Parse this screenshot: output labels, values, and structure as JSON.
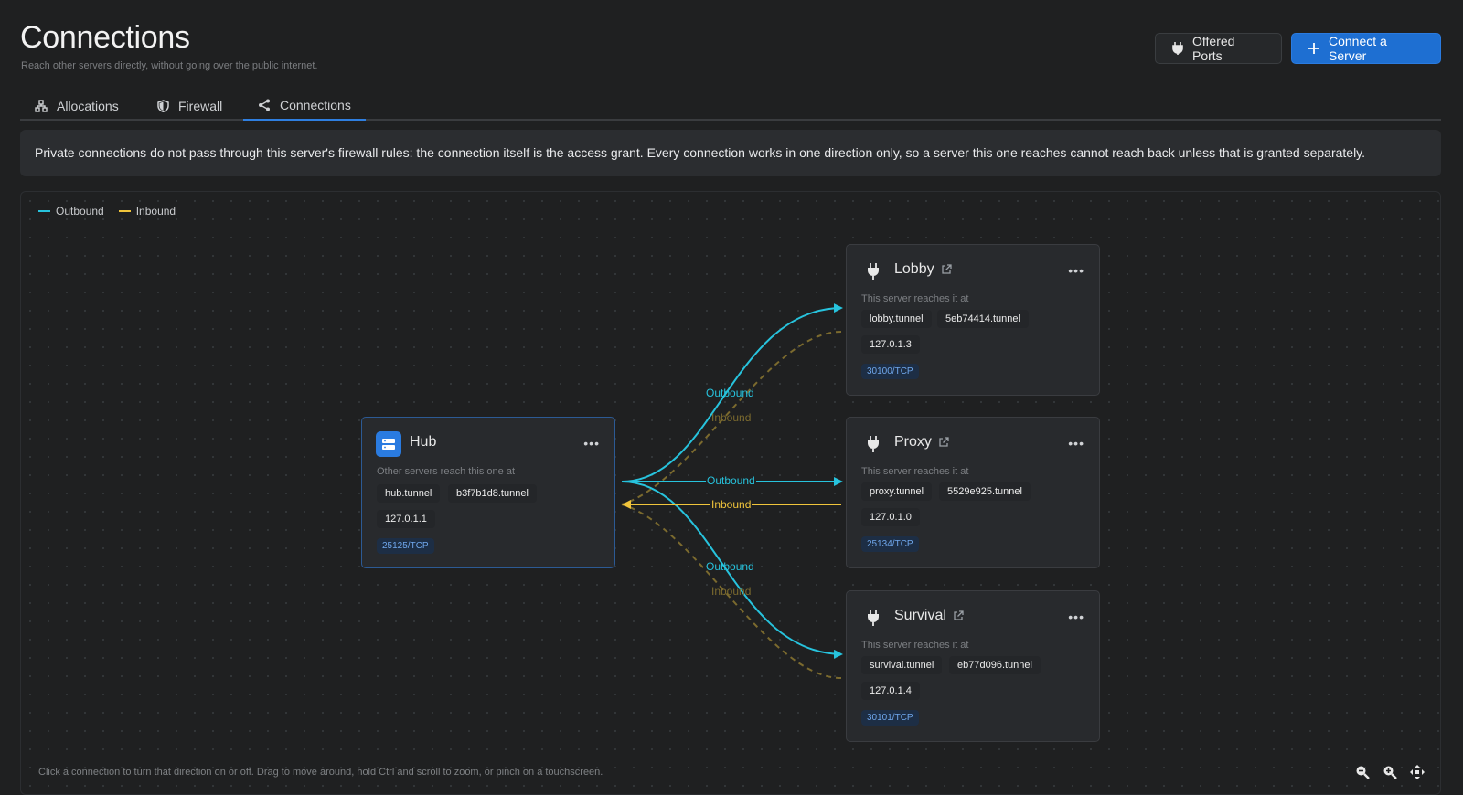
{
  "header": {
    "title": "Connections",
    "subtitle": "Reach other servers directly, without going over the public internet.",
    "offered_ports_label": "Offered Ports",
    "connect_label": "Connect a Server"
  },
  "tabs": [
    {
      "label": "Allocations",
      "icon": "allocations-icon"
    },
    {
      "label": "Firewall",
      "icon": "shield-icon"
    },
    {
      "label": "Connections",
      "icon": "share-icon",
      "active": true
    }
  ],
  "notice": "Private connections do not pass through this server's firewall rules: the connection itself is the access grant. Every connection works in one direction only, so a server this one reaches cannot reach back unless that is granted separately.",
  "legend": {
    "outbound": "Outbound",
    "inbound": "Inbound",
    "outbound_color": "#27c3dd",
    "inbound_color": "#f0c43b"
  },
  "hub": {
    "name": "Hub",
    "caption": "Other servers reach this one at",
    "host1": "hub.tunnel",
    "host2": "b3f7b1d8.tunnel",
    "ip": "127.0.1.1",
    "port": "25125/TCP"
  },
  "servers": [
    {
      "name": "Lobby",
      "caption": "This server reaches it at",
      "host1": "lobby.tunnel",
      "host2": "5eb74414.tunnel",
      "ip": "127.0.1.3",
      "port": "30100/TCP"
    },
    {
      "name": "Proxy",
      "caption": "This server reaches it at",
      "host1": "proxy.tunnel",
      "host2": "5529e925.tunnel",
      "ip": "127.0.1.0",
      "port": "25134/TCP"
    },
    {
      "name": "Survival",
      "caption": "This server reaches it at",
      "host1": "survival.tunnel",
      "host2": "eb77d096.tunnel",
      "ip": "127.0.1.4",
      "port": "30101/TCP"
    }
  ],
  "edges": {
    "lobby_out": "Outbound",
    "lobby_in": "Inbound",
    "proxy_out": "Outbound",
    "proxy_in": "Inbound",
    "survival_out": "Outbound",
    "survival_in": "Inbound"
  },
  "help_text": "Click a connection to turn that direction on or off. Drag to move around, hold Ctrl and scroll to zoom, or pinch on a touchscreen."
}
